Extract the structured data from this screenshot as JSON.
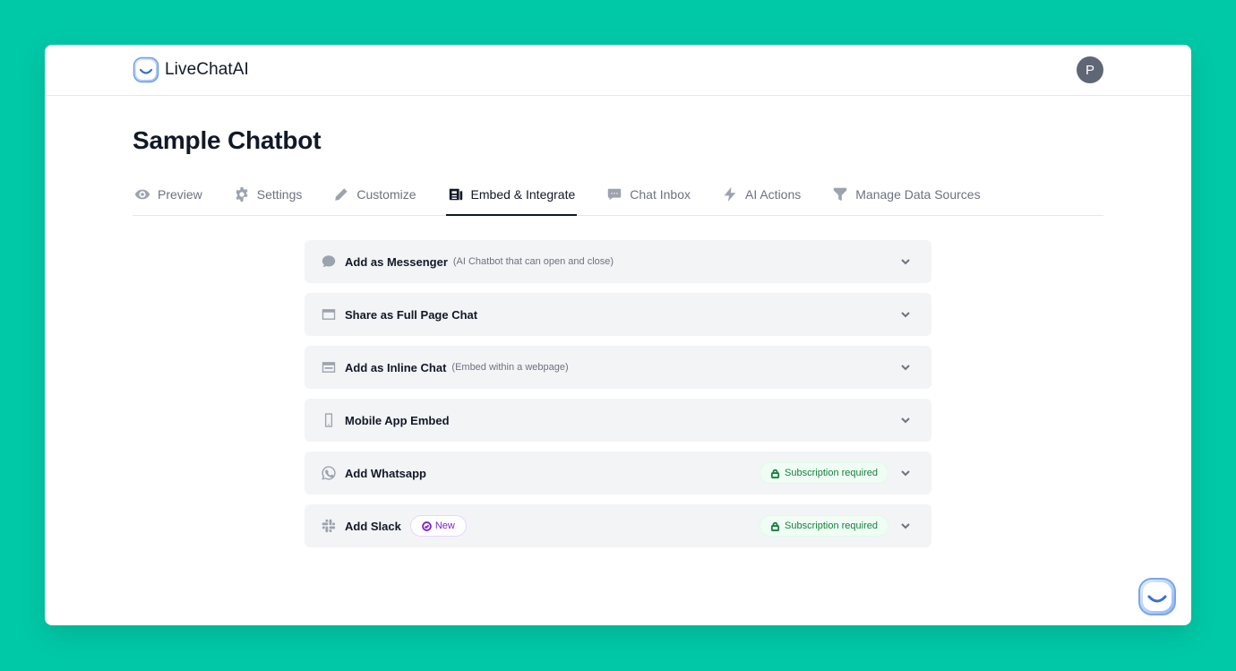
{
  "header": {
    "brand_name": "LiveChatAI",
    "avatar_initial": "P"
  },
  "page": {
    "title": "Sample Chatbot"
  },
  "tabs": [
    {
      "label": "Preview",
      "icon": "eye-icon"
    },
    {
      "label": "Settings",
      "icon": "gear-icon"
    },
    {
      "label": "Customize",
      "icon": "pencil-icon"
    },
    {
      "label": "Embed & Integrate",
      "icon": "newspaper-icon",
      "active": true
    },
    {
      "label": "Chat Inbox",
      "icon": "chat-icon"
    },
    {
      "label": "AI Actions",
      "icon": "lightning-icon"
    },
    {
      "label": "Manage Data Sources",
      "icon": "funnel-icon"
    }
  ],
  "accordion": [
    {
      "title": "Add as Messenger",
      "note": "(AI Chatbot that can open and close)",
      "icon": "speech-bubble-icon"
    },
    {
      "title": "Share as Full Page Chat",
      "icon": "browser-window-icon"
    },
    {
      "title": "Add as Inline Chat",
      "note": "(Embed within a webpage)",
      "icon": "inline-window-icon"
    },
    {
      "title": "Mobile App Embed",
      "icon": "mobile-phone-icon"
    },
    {
      "title": "Add Whatsapp",
      "icon": "whatsapp-icon",
      "badge": "Subscription required"
    },
    {
      "title": "Add Slack",
      "icon": "slack-icon",
      "new_badge": "New",
      "badge": "Subscription required"
    }
  ],
  "colors": {
    "background": "#00c9a7",
    "subscription_badge": "#15803d",
    "new_badge": "#7e22ce"
  }
}
